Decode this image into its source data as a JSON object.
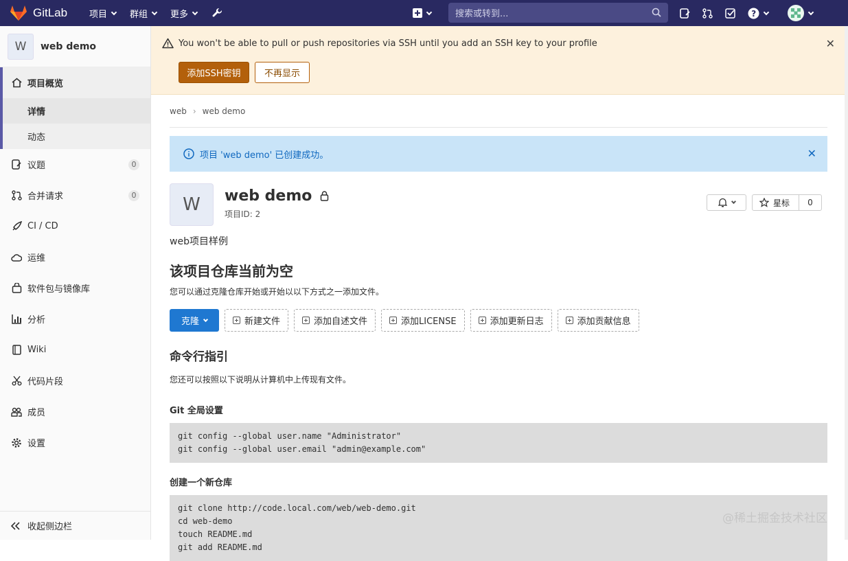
{
  "topbar": {
    "brand": "GitLab",
    "nav": [
      "项目",
      "群组",
      "更多"
    ],
    "search_placeholder": "搜索或转到..."
  },
  "sidebar": {
    "project_initial": "W",
    "project_name": "web demo",
    "section_overview": "项目概览",
    "sub_details": "详情",
    "sub_activity": "动态",
    "items": [
      {
        "label": "议题",
        "count": "0"
      },
      {
        "label": "合并请求",
        "count": "0"
      },
      {
        "label": "CI / CD"
      },
      {
        "label": "运维"
      },
      {
        "label": "软件包与镜像库"
      },
      {
        "label": "分析"
      },
      {
        "label": "Wiki"
      },
      {
        "label": "代码片段"
      },
      {
        "label": "成员"
      },
      {
        "label": "设置"
      }
    ],
    "collapse_label": "收起侧边栏"
  },
  "ssh_alert": {
    "text": "You won't be able to pull or push repositories via SSH until you add an SSH key to your profile",
    "add_button": "添加SSH密钥",
    "dismiss_button": "不再显示"
  },
  "breadcrumb": {
    "group": "web",
    "project": "web demo"
  },
  "flash": {
    "text": "项目 'web demo' 已创建成功。"
  },
  "project": {
    "initial": "W",
    "title": "web demo",
    "id_label": "项目ID: 2",
    "star_label": "星标",
    "star_count": "0",
    "description": "web项目样例"
  },
  "empty": {
    "title": "该项目仓库当前为空",
    "subtitle": "您可以通过克隆仓库开始或开始以以下方式之一添加文件。",
    "clone_button": "克隆",
    "actions": [
      "新建文件",
      "添加自述文件",
      "添加LICENSE",
      "添加更新日志",
      "添加贡献信息"
    ]
  },
  "cli": {
    "title": "命令行指引",
    "intro": "您还可以按照以下说明从计算机中上传现有文件。",
    "global_title": "Git 全局设置",
    "global_code": "git config --global user.name \"Administrator\"\ngit config --global user.email \"admin@example.com\"",
    "new_repo_title": "创建一个新仓库",
    "new_repo_code": "git clone http://code.local.com/web/web-demo.git\ncd web-demo\ntouch README.md\ngit add README.md"
  },
  "watermark": "@稀土掘金技术社区"
}
